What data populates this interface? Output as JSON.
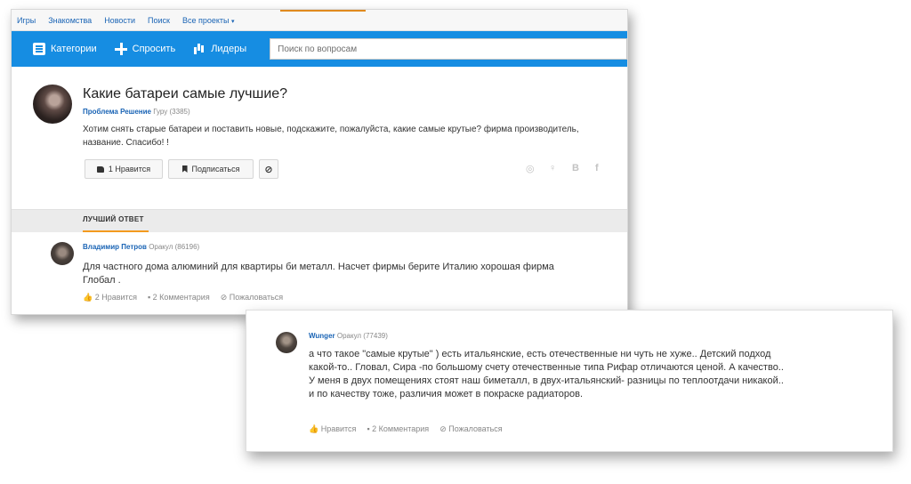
{
  "topnav": {
    "items": [
      "Игры",
      "Знакомства",
      "Новости",
      "Поиск",
      "Все проекты"
    ],
    "caret": "▾"
  },
  "toolbar": {
    "categories_label": "Категории",
    "ask_label": "Спросить",
    "leaders_label": "Лидеры",
    "search_placeholder": "Поиск по вопросам"
  },
  "question": {
    "title": "Какие батареи самые лучшие?",
    "author": "Проблема Решение",
    "rank": "Гуру (3385)",
    "body": "Хотим снять старые батареи и поставить новые, подскажите, пожалуйста, какие самые крутые? фирма производитель, название. Спасибо! !",
    "like_label": "1 Нравится",
    "subscribe_label": "Подписаться",
    "block_label": "⊘",
    "social": [
      "◎",
      "♀",
      "В",
      "f"
    ]
  },
  "best_answer_label": "ЛУЧШИЙ ОТВЕТ",
  "answers": [
    {
      "author": "Владимир Петров",
      "rank": "Оракул (86196)",
      "body": "Для частного дома алюминий для квартиры би металл. Насчет фирмы берите Италию хорошая фирма Глобал .",
      "like": "2 Нравится",
      "comments": "2 Комментария",
      "report": "Пожаловаться"
    },
    {
      "author": "Wunger",
      "rank": "Оракул (77439)",
      "body": "а что такое \"самые крутые\" ) есть итальянские, есть отечественные ни чуть не хуже.. Детский подход какой-то.. Гловал, Сира -по большому счету отечественные типа Рифар отличаются ценой. А качество.. У меня в двух помещениях стоят наш биметалл, в двух-итальянский- разницы по теплоотдачи никакой.. и по качеству тоже, различия может в покраске радиаторов.",
      "like": "Нравится",
      "comments": "2 Комментария",
      "report": "Пожаловаться"
    }
  ],
  "colors": {
    "brand_blue": "#168de2",
    "link_blue": "#1a64b5",
    "accent_orange": "#f39a1e"
  }
}
